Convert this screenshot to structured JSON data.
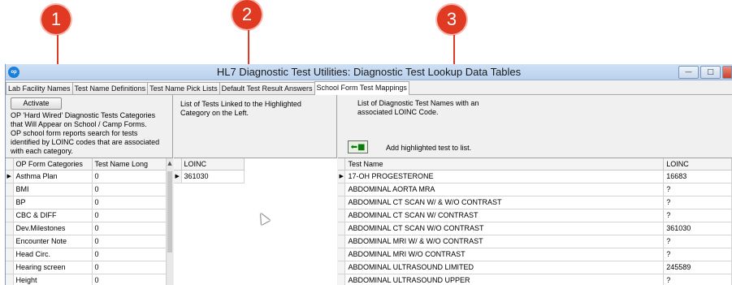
{
  "markers": [
    "1",
    "2",
    "3"
  ],
  "colors": {
    "marker": "#e03a22",
    "titlebar": "#c4d8f0",
    "selected_row_marker": "#000000"
  },
  "window": {
    "title": "HL7 Diagnostic Test Utilities:  Diagnostic Test Lookup Data Tables",
    "app_icon": "op-app-icon",
    "controls": [
      "minimize-icon",
      "maximize-icon",
      "close-icon"
    ]
  },
  "tabs": [
    {
      "label": "Lab Facility Names"
    },
    {
      "label": "Test Name Definitions"
    },
    {
      "label": "Test Name Pick Lists"
    },
    {
      "label": "Default Test Result Answers"
    },
    {
      "label": "School Form Test Mappings",
      "active": true
    }
  ],
  "left_panel": {
    "activate_label": "Activate",
    "description": "OP 'Hard Wired' Diagnostic Tests Categories\nthat Will Appear on School / Camp Forms.\nOP school form reports search for tests\nidentified by LOINC codes that are associated\nwith each category.",
    "columns": [
      "OP Form Categories",
      "Test Name Long"
    ],
    "rows": [
      [
        "Asthma Plan",
        "0"
      ],
      [
        "BMI",
        "0"
      ],
      [
        "BP",
        "0"
      ],
      [
        "CBC & DIFF",
        "0"
      ],
      [
        "Dev.Milestones",
        "0"
      ],
      [
        "Encounter Note",
        "0"
      ],
      [
        "Head Circ.",
        "0"
      ],
      [
        "Hearing screen",
        "0"
      ],
      [
        "Height",
        "0"
      ]
    ]
  },
  "middle_panel": {
    "description": "List of Tests Linked to the Highlighted\nCategory on the Left.",
    "columns": [
      "LOINC"
    ],
    "rows": [
      [
        "361030"
      ]
    ]
  },
  "right_panel": {
    "description": "List of Diagnostic Test Names with an\nassociated  LOINC Code.",
    "add_icon": "add-arrow-icon",
    "add_label": "Add highlighted test to list.",
    "columns": [
      "Test Name",
      "LOINC"
    ],
    "rows": [
      [
        "17-OH PROGESTERONE",
        "16683"
      ],
      [
        "ABDOMINAL AORTA MRA",
        "?"
      ],
      [
        "ABDOMINAL CT SCAN W/ & W/O CONTRAST",
        "?"
      ],
      [
        "ABDOMINAL CT SCAN W/ CONTRAST",
        "?"
      ],
      [
        "ABDOMINAL CT SCAN W/O CONTRAST",
        "361030"
      ],
      [
        "ABDOMINAL MRI W/ & W/O CONTRAST",
        "?"
      ],
      [
        "ABDOMINAL MRI W/O CONTRAST",
        "?"
      ],
      [
        "ABDOMINAL ULTRASOUND LIMITED",
        "245589"
      ],
      [
        "ABDOMINAL ULTRASOUND UPPER",
        "?"
      ]
    ]
  }
}
